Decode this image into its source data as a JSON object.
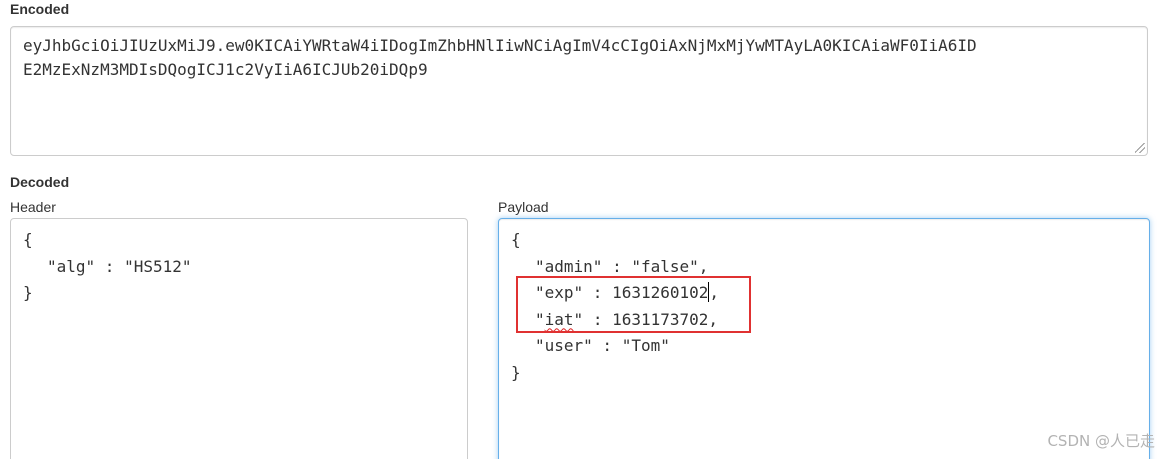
{
  "encoded": {
    "label": "Encoded",
    "line1": "eyJhbGciOiJIUzUxMiJ9.ew0KICAiYWRtaW4iIDogImZhbHNlIiwNCiAgImV4cCIgOiAxNjMxMjYwMTAyLA0KICAiaWF0IiA6ID",
    "line2": "E2MzExNzM3MDIsDQogICJ1c2VyIiA6ICJUb20iDQp9"
  },
  "decoded": {
    "label": "Decoded",
    "header": {
      "label": "Header",
      "open": "{",
      "alg_line": "\"alg\" : \"HS512\"",
      "close": "}"
    },
    "payload": {
      "label": "Payload",
      "open": "{",
      "admin_line": "\"admin\" : \"false\",",
      "exp_key": "\"exp\" : 1631260102",
      "exp_tail": ",",
      "iat_pre": "\"",
      "iat_word": "iat",
      "iat_post": "\" : 1631173702,",
      "user_line": "\"user\" : \"Tom\"",
      "close": "}"
    }
  },
  "watermark": "CSDN @人已走",
  "colors": {
    "highlight": "#e03131",
    "focus_border": "#66afe9"
  }
}
